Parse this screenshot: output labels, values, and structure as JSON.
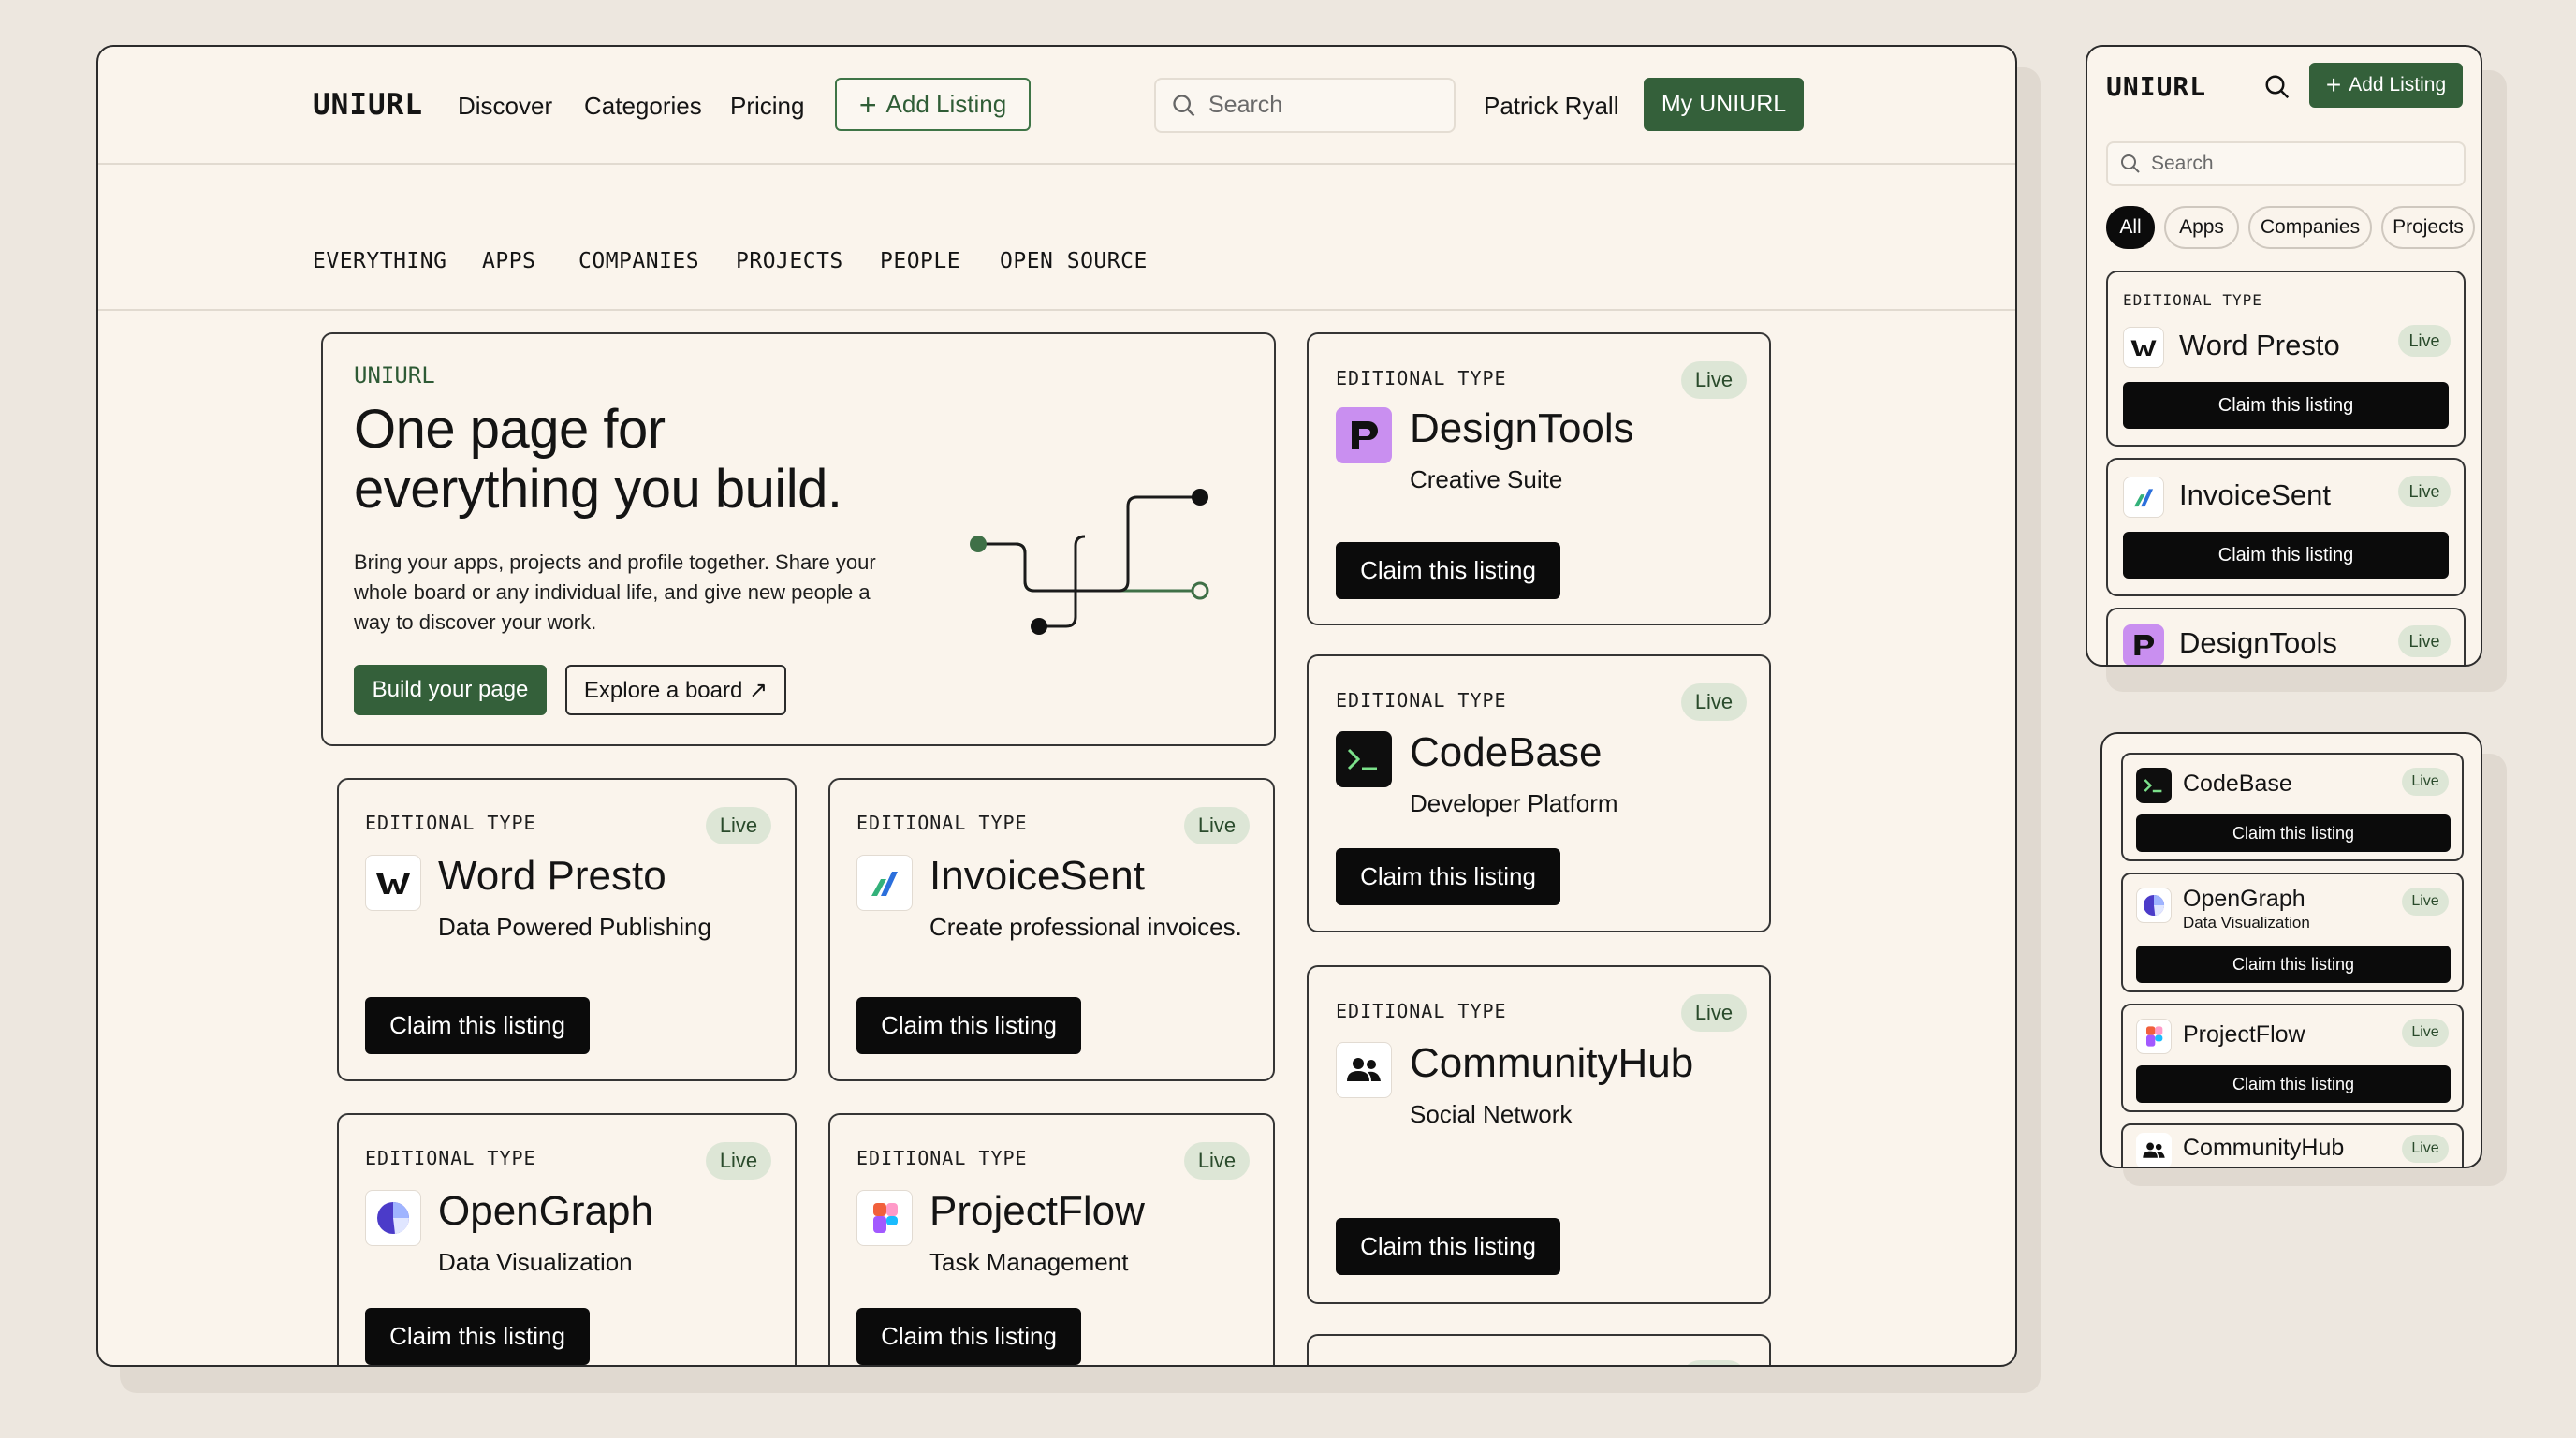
{
  "brand": "UNIURL",
  "nav": {
    "links": [
      "Discover",
      "Categories",
      "Pricing"
    ],
    "add_listing": "Add Listing",
    "search_placeholder": "Search",
    "user_name": "Patrick Ryall",
    "my_button": "My UNIURL"
  },
  "categories": [
    "EVERYTHING",
    "APPS",
    "COMPANIES",
    "PROJECTS",
    "PEOPLE",
    "OPEN SOURCE"
  ],
  "hero": {
    "eyebrow": "UNIURL",
    "title_line1": "One page for",
    "title_line2": "everything you build.",
    "body_line1": "Bring your apps, projects and profile together. Share your",
    "body_line2": "whole board or any individual life, and give new people a",
    "body_line3": "way to discover your work.",
    "primary_button": "Build your page",
    "secondary_button": "Explore a board ↗"
  },
  "listing_common": {
    "eyebrow": "EDITIONAL TYPE",
    "status": "Live",
    "claim": "Claim this listing"
  },
  "listings": [
    {
      "name": "DesignTools",
      "subtitle": "Creative Suite",
      "icon": "designtools-logo-icon",
      "color": "#c98ff0"
    },
    {
      "name": "CodeBase",
      "subtitle": "Developer Platform",
      "icon": "terminal-icon",
      "color": "#0e0e0e"
    },
    {
      "name": "CommunityHub",
      "subtitle": "Social Network",
      "icon": "people-icon",
      "color": "#ffffff"
    },
    {
      "name": "Word Presto",
      "subtitle": "Data Powered Publishing",
      "icon": "wordpresto-logo-icon",
      "color": "#ffffff"
    },
    {
      "name": "InvoiceSent",
      "subtitle": "Create professional invoices.",
      "icon": "invoicesent-logo-icon",
      "color": "#ffffff"
    },
    {
      "name": "OpenGraph",
      "subtitle": "Data Visualization",
      "icon": "opengraph-logo-icon",
      "color": "#ffffff"
    },
    {
      "name": "ProjectFlow",
      "subtitle": "Task Management",
      "icon": "projectflow-logo-icon",
      "color": "#ffffff"
    }
  ],
  "mobile": {
    "brand": "UNIURL",
    "add_listing": "Add Listing",
    "search_placeholder": "Search",
    "filters": [
      "All",
      "Apps",
      "Companies",
      "Projects"
    ],
    "active_filter": "All"
  },
  "colors": {
    "accent_green": "#34603a",
    "background": "#faf4ec",
    "live_badge": "#dde6d6"
  }
}
